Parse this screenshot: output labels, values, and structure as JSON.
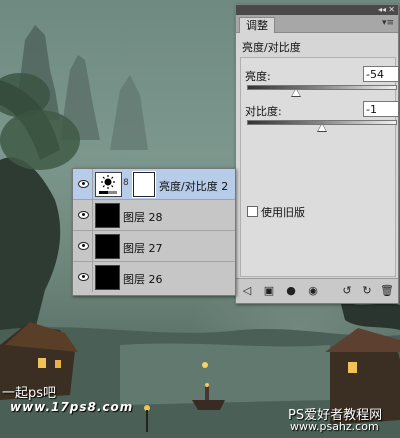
{
  "adjustments_panel": {
    "tab_label": "调整",
    "title": "亮度/对比度",
    "brightness_label": "亮度:",
    "brightness_value": "-54",
    "contrast_label": "对比度:",
    "contrast_value": "-1",
    "legacy_label": "使用旧版",
    "legacy_checked": false
  },
  "layers_panel": {
    "layers": [
      {
        "name": "亮度/对比度 2",
        "type": "adjustment",
        "selected": true,
        "visible": true
      },
      {
        "name": "图层 28",
        "type": "pixel",
        "selected": false,
        "visible": true
      },
      {
        "name": "图层 27",
        "type": "pixel",
        "selected": false,
        "visible": true
      },
      {
        "name": "图层 26",
        "type": "pixel",
        "selected": false,
        "visible": true
      }
    ]
  },
  "watermarks": {
    "left_line1": "一起ps吧",
    "left_line2": "www.17ps8.com",
    "right_line1": "PS爱好者教程网",
    "right_line2": "www.psahz.com"
  },
  "colors": {
    "panel_bg": "#d6d6d6",
    "selected_row": "#b6cce8",
    "topbar": "#4a4a4a"
  },
  "icons": {
    "footer": [
      "back-arrow-icon",
      "panel-view-icon",
      "clip-icon",
      "visibility-icon",
      "view-previous-icon",
      "reset-icon",
      "delete-icon"
    ]
  }
}
